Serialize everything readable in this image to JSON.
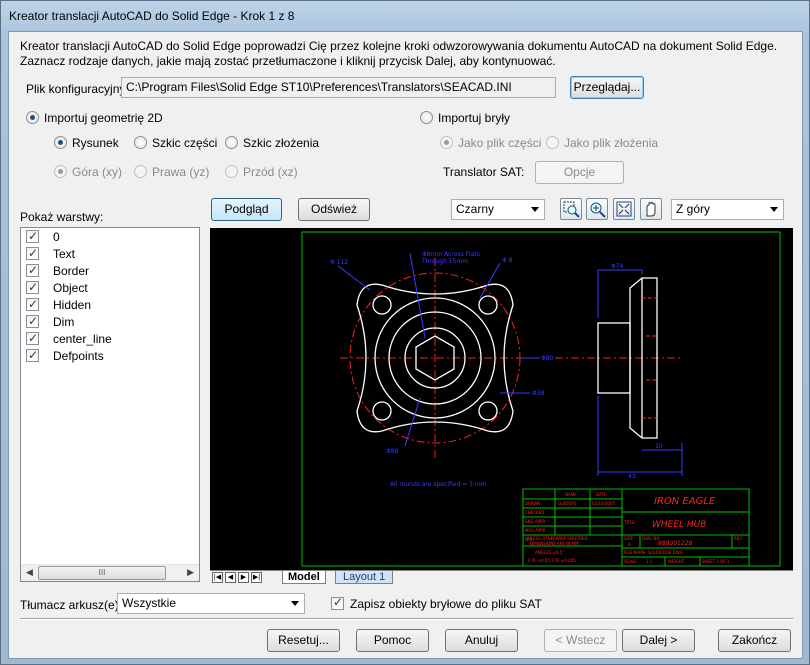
{
  "window": {
    "title": "Kreator translacji AutoCAD do Solid Edge - Krok 1 z 8"
  },
  "description": "Kreator translacji AutoCAD do Solid Edge poprowadzi Cię przez kolejne kroki odwzorowywania dokumentu AutoCAD na dokument Solid Edge. Zaznacz rodzaje danych, jakie mają zostać przetłumaczone i kliknij przycisk Dalej, aby kontynuować.",
  "config": {
    "label": "Plik konfiguracyjny:",
    "value": "C:\\Program Files\\Solid Edge ST10\\Preferences\\Translators\\SEACAD.INI",
    "browse_label": "Przeglądaj..."
  },
  "import_2d": {
    "label": "Importuj geometrię 2D",
    "selected": true,
    "type_options": [
      {
        "label": "Rysunek",
        "selected": true
      },
      {
        "label": "Szkic części",
        "selected": false
      },
      {
        "label": "Szkic złożenia",
        "selected": false
      }
    ],
    "view_options": [
      {
        "label": "Góra (xy)",
        "selected": true
      },
      {
        "label": "Prawa (yz)",
        "selected": false
      },
      {
        "label": "Przód (xz)",
        "selected": false
      }
    ]
  },
  "import_solids": {
    "label": "Importuj bryły",
    "selected": false,
    "options": [
      {
        "label": "Jako plik części",
        "selected": true
      },
      {
        "label": "Jako plik złożenia",
        "selected": false
      }
    ],
    "sat_label": "Translator SAT:",
    "sat_button": "Opcje"
  },
  "layers": {
    "label": "Pokaż warstwy:",
    "items": [
      {
        "name": "0",
        "checked": true
      },
      {
        "name": "Text",
        "checked": true
      },
      {
        "name": "Border",
        "checked": true
      },
      {
        "name": "Object",
        "checked": true
      },
      {
        "name": "Hidden",
        "checked": true
      },
      {
        "name": "Dim",
        "checked": true
      },
      {
        "name": "center_line",
        "checked": true
      },
      {
        "name": "Defpoints",
        "checked": true
      }
    ],
    "scroll_thumb": "III"
  },
  "preview_toolbar": {
    "preview_label": "Podgląd",
    "refresh_label": "Odśwież",
    "background_value": "Czarny",
    "view_value": "Z góry",
    "icons": [
      "zoom-area-icon",
      "zoom-icon",
      "zoom-fit-icon",
      "pan-icon"
    ]
  },
  "drawing": {
    "annotations": {
      "top_left": "Φ 112",
      "top_center_1": "Φ8mm Across Flats",
      "top_center_2": "Through 15mm",
      "top_right": "Φ 8",
      "right_1": "Φ80",
      "right_2": "Φ38",
      "bottom_left": "Φ88",
      "fillets": "All rounds are specified = 3 mm",
      "side_top": "Φ74",
      "side_right": "10",
      "side_bottom": "43"
    },
    "title_block": {
      "company": "IRON EAGLE",
      "title": "WHEEL HUB",
      "name_header": "NAME",
      "date_header": "DATE",
      "drawn": "DRAWN",
      "checked": "CHECKED",
      "eng_appr": "ENG APPR",
      "mfg_appr": "MFG APPR",
      "qa": "Q.A.",
      "name_value": "GUIDOFE",
      "date_value": "02/10/2005",
      "title_label": "TITLE",
      "size_label": "SIZE",
      "dwg_label": "DWG NO",
      "rev_label": "REV",
      "size_value": "A",
      "dwg_value": "988301228",
      "file_label": "FILE NAME",
      "file_value": "SOLIDEDGE.DWG",
      "scale_label": "SCALE",
      "scale_value": "1:1",
      "weight_label": "WEIGHT",
      "sheet_label": "SHEET 1 OF 1",
      "notes_1": "UNLESS OTHERWISE SPECIFIED",
      "notes_2": "DIMENSIONS ARE IN MM",
      "notes_3": "ANGLES ±0.5°",
      "notes_4": "2 PL ±0.05  3 PL ±0.005"
    }
  },
  "tabs": {
    "items": [
      {
        "label": "Model",
        "active": true
      },
      {
        "label": "Layout 1",
        "active": false
      }
    ]
  },
  "sheets": {
    "label": "Tłumacz arkusz(e):",
    "value": "Wszystkie"
  },
  "save_solids": {
    "label": "Zapisz obiekty bryłowe do pliku SAT",
    "checked": true
  },
  "footer": {
    "reset": "Resetuj...",
    "help": "Pomoc",
    "cancel": "Anuluj",
    "back": "< Wstecz",
    "next": "Dalej >",
    "finish": "Zakończ"
  },
  "colors": {
    "drawing_white": "#ffffff",
    "drawing_blue": "#3a3aff",
    "drawing_red": "#ff2020",
    "drawing_green": "#00c000"
  }
}
